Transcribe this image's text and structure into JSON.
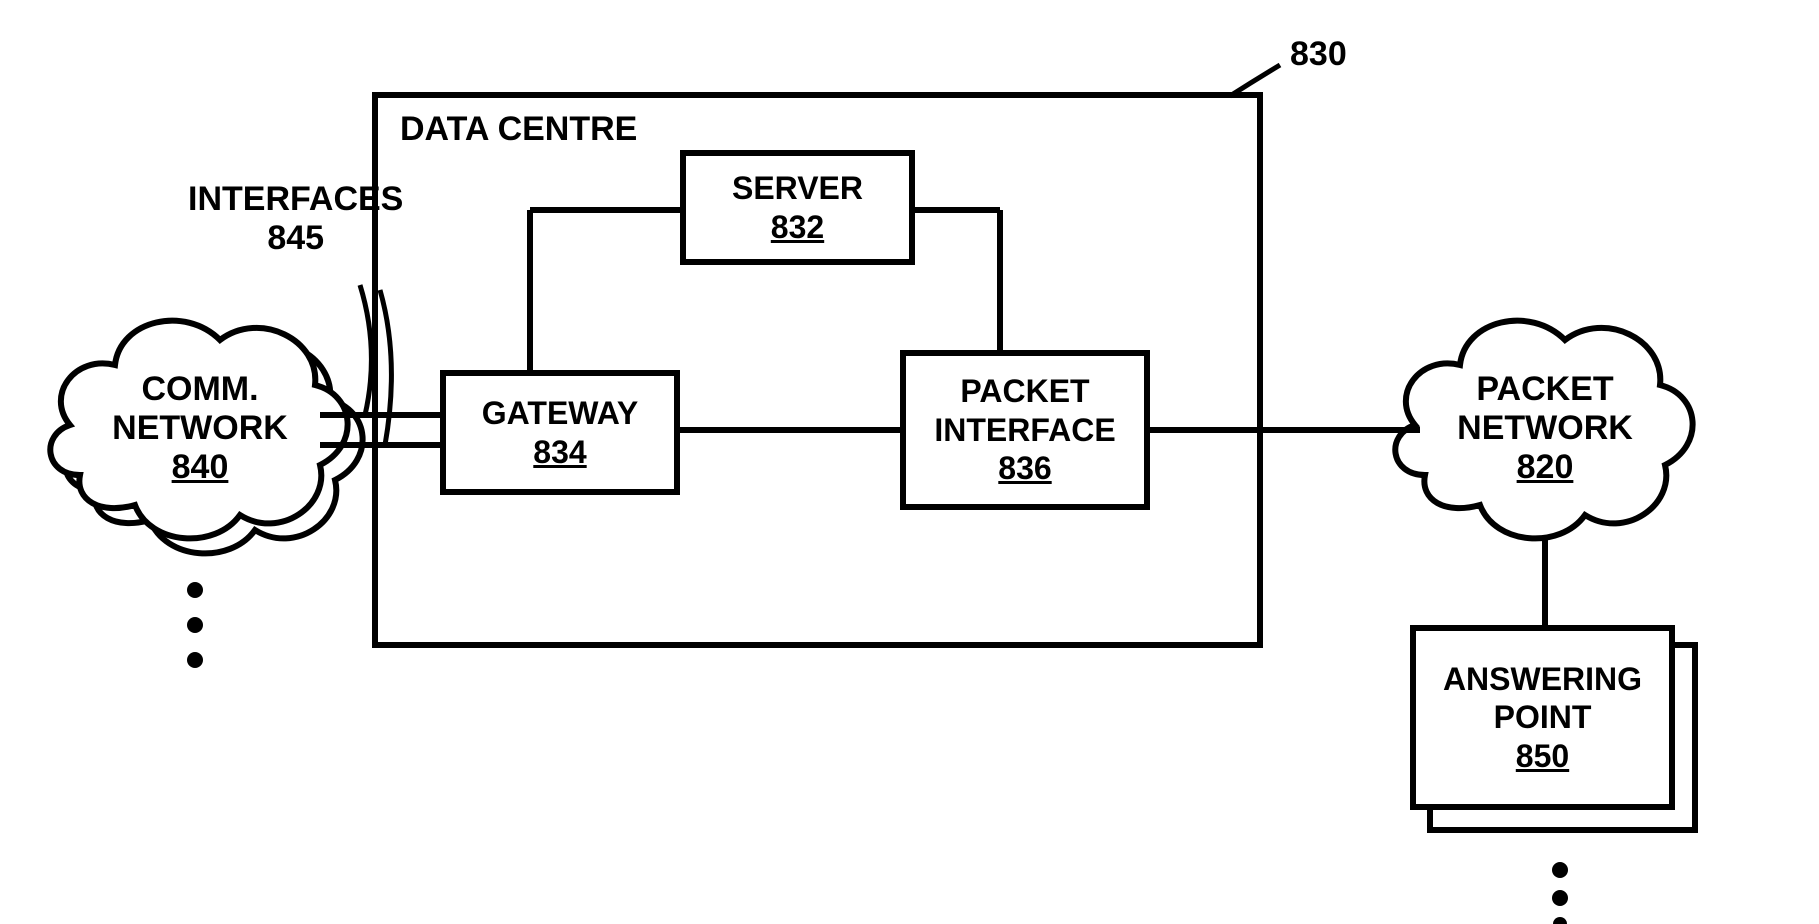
{
  "labels": {
    "data_centre_ref": "830",
    "data_centre_title": "DATA CENTRE",
    "interfaces_label": "INTERFACES",
    "interfaces_ref": "845"
  },
  "blocks": {
    "server": {
      "name": "SERVER",
      "ref": "832"
    },
    "gateway": {
      "name": "GATEWAY",
      "ref": "834"
    },
    "packet_interface": {
      "name": "PACKET INTERFACE",
      "ref": "836"
    },
    "comm_network": {
      "name": "COMM. NETWORK",
      "ref": "840"
    },
    "packet_network": {
      "name": "PACKET NETWORK",
      "ref": "820"
    },
    "answering_point": {
      "name": "ANSWERING POINT",
      "ref": "850"
    }
  }
}
